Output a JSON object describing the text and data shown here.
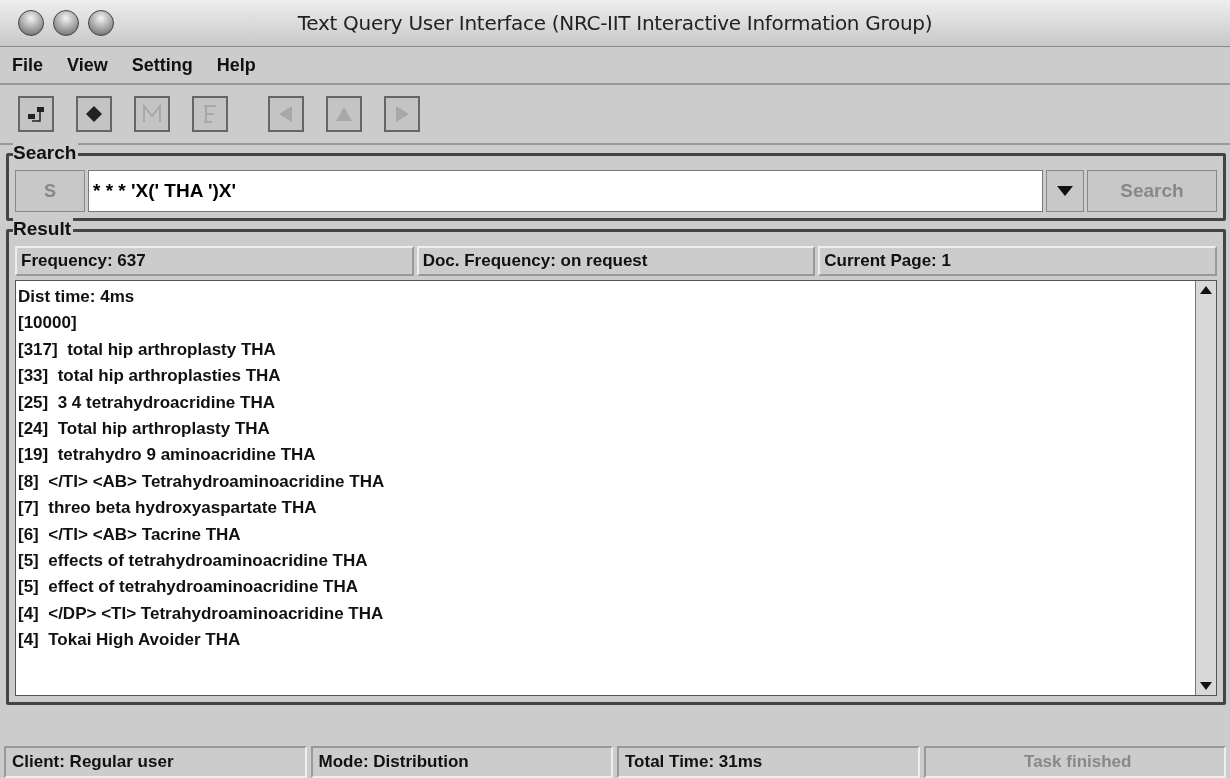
{
  "window": {
    "title": "Text Query User Interface (NRC-IIT Interactive Information Group)"
  },
  "menu": [
    {
      "label": "File"
    },
    {
      "label": "View"
    },
    {
      "label": "Setting"
    },
    {
      "label": "Help"
    }
  ],
  "toolbar": [
    {
      "kind": "tree",
      "disabled": false
    },
    {
      "kind": "diamond",
      "disabled": false
    },
    {
      "kind": "m",
      "disabled": true
    },
    {
      "kind": "doc",
      "disabled": true
    },
    {
      "kind": "left",
      "disabled": true
    },
    {
      "kind": "up",
      "disabled": true
    },
    {
      "kind": "right",
      "disabled": true
    }
  ],
  "search": {
    "title": "Search",
    "s_button": {
      "label": "S",
      "disabled": true
    },
    "value": "* * * 'X(' THA ')X'",
    "button": {
      "label": "Search",
      "disabled": true
    }
  },
  "result": {
    "title": "Result",
    "info": [
      "Frequency: 637",
      "Doc. Frequency: on request",
      "Current Page: 1"
    ],
    "lines": [
      "Dist time: 4ms",
      "[10000]",
      "[317]  total hip arthroplasty THA",
      "[33]  total hip arthroplasties THA",
      "[25]  3 4 tetrahydroacridine THA",
      "[24]  Total hip arthroplasty THA",
      "[19]  tetrahydro 9 aminoacridine THA",
      "[8]  </TI> <AB> Tetrahydroaminoacridine THA",
      "[7]  threo beta hydroxyaspartate THA",
      "[6]  </TI> <AB> Tacrine THA",
      "[5]  effects of tetrahydroaminoacridine THA",
      "[5]  effect of tetrahydroaminoacridine THA",
      "[4]  </DP> <TI> Tetrahydroaminoacridine THA",
      "[4]  Tokai High Avoider THA"
    ]
  },
  "status_bar": [
    {
      "text": "Client: Regular user",
      "disabled": false
    },
    {
      "text": "Mode: Distribution",
      "disabled": false
    },
    {
      "text": "Total Time: 31ms",
      "disabled": false
    },
    {
      "text": "Task finished",
      "disabled": true
    }
  ]
}
